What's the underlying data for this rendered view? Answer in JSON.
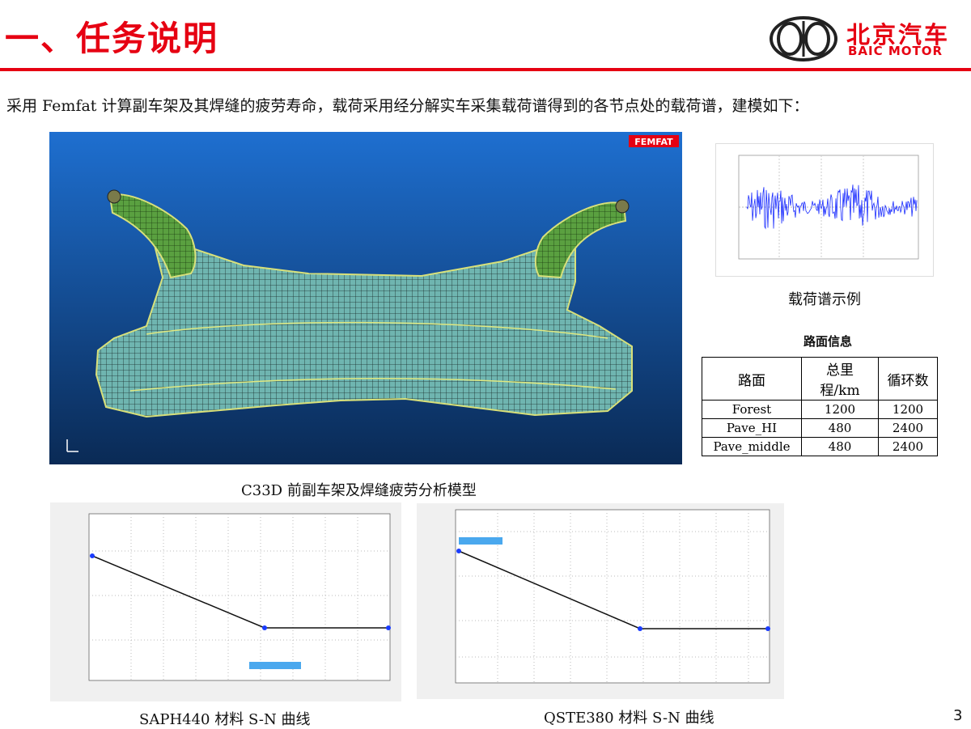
{
  "header": {
    "title": "一、任务说明"
  },
  "logo": {
    "cn": "北京汽车",
    "en": "BAIC MOTOR"
  },
  "intro": "采用 Femfat 计算副车架及其焊缝的疲劳寿命，载荷采用经分解实车采集载荷谱得到的各节点处的载荷谱，建模如下：",
  "model": {
    "badge": "FEMFAT",
    "caption": "C33D 前副车架及焊缝疲劳分析模型"
  },
  "load_spectrum": {
    "caption": "载荷谱示例"
  },
  "road_table": {
    "title": "路面信息",
    "headers": [
      "路面",
      "总里程/km",
      "循环数"
    ],
    "rows": [
      [
        "Forest",
        "1200",
        "1200"
      ],
      [
        "Pave_HI",
        "480",
        "2400"
      ],
      [
        "Pave_middle",
        "480",
        "2400"
      ]
    ]
  },
  "sn_left": {
    "caption": "SAPH440  材料 S-N 曲线"
  },
  "sn_right": {
    "caption": "QSTE380  材料 S-N 曲线"
  },
  "page": {
    "number": "3"
  },
  "colors": {
    "brand": "#e60012",
    "mesh_bg_top": "#1565c0",
    "mesh_bg_bottom": "#0a2a55",
    "curve_marker": "#1a3cff"
  }
}
